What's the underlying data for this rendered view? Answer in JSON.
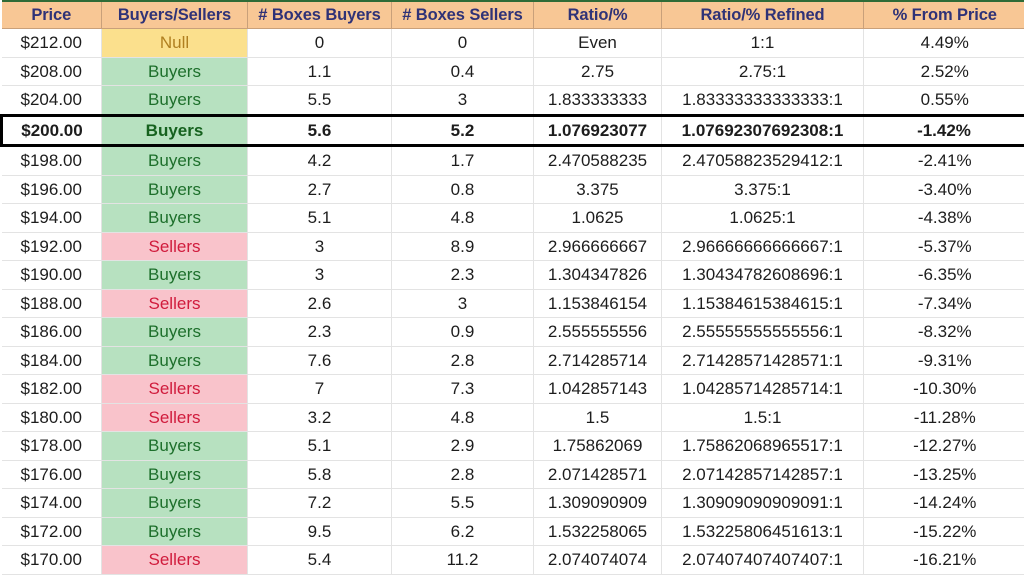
{
  "table": {
    "columns": [
      {
        "key": "price",
        "label": "Price"
      },
      {
        "key": "signal",
        "label": "Buyers/Sellers"
      },
      {
        "key": "boxes_buyers",
        "label": "# Boxes Buyers"
      },
      {
        "key": "boxes_sellers",
        "label": "# Boxes Sellers"
      },
      {
        "key": "ratio",
        "label": "Ratio/%"
      },
      {
        "key": "refined",
        "label": "Ratio/% Refined"
      },
      {
        "key": "pct",
        "label": "% From Price"
      }
    ],
    "colors": {
      "header_bg": "#f8c795",
      "header_text": "#2f3277",
      "header_top_rule": "#2f6b37",
      "buyers_bg": "#b7e1c0",
      "buyers_text": "#1d6f2b",
      "sellers_bg": "#f9c3cb",
      "sellers_text": "#d01b3c",
      "null_bg": "#fbe08d",
      "null_text": "#b07f20",
      "focus_border": "#000000",
      "gridline": "#e3e3e3"
    },
    "focus_row_index": 3,
    "rows": [
      {
        "price": "$212.00",
        "signal": "Null",
        "signal_kind": "null",
        "boxes_buyers": "0",
        "boxes_sellers": "0",
        "ratio": "Even",
        "refined": "1:1",
        "pct": "4.49%"
      },
      {
        "price": "$208.00",
        "signal": "Buyers",
        "signal_kind": "buyers",
        "boxes_buyers": "1.1",
        "boxes_sellers": "0.4",
        "ratio": "2.75",
        "refined": "2.75:1",
        "pct": "2.52%"
      },
      {
        "price": "$204.00",
        "signal": "Buyers",
        "signal_kind": "buyers",
        "boxes_buyers": "5.5",
        "boxes_sellers": "3",
        "ratio": "1.833333333",
        "refined": "1.83333333333333:1",
        "pct": "0.55%"
      },
      {
        "price": "$200.00",
        "signal": "Buyers",
        "signal_kind": "buyers",
        "boxes_buyers": "5.6",
        "boxes_sellers": "5.2",
        "ratio": "1.076923077",
        "refined": "1.07692307692308:1",
        "pct": "-1.42%"
      },
      {
        "price": "$198.00",
        "signal": "Buyers",
        "signal_kind": "buyers",
        "boxes_buyers": "4.2",
        "boxes_sellers": "1.7",
        "ratio": "2.470588235",
        "refined": "2.47058823529412:1",
        "pct": "-2.41%"
      },
      {
        "price": "$196.00",
        "signal": "Buyers",
        "signal_kind": "buyers",
        "boxes_buyers": "2.7",
        "boxes_sellers": "0.8",
        "ratio": "3.375",
        "refined": "3.375:1",
        "pct": "-3.40%"
      },
      {
        "price": "$194.00",
        "signal": "Buyers",
        "signal_kind": "buyers",
        "boxes_buyers": "5.1",
        "boxes_sellers": "4.8",
        "ratio": "1.0625",
        "refined": "1.0625:1",
        "pct": "-4.38%"
      },
      {
        "price": "$192.00",
        "signal": "Sellers",
        "signal_kind": "sellers",
        "boxes_buyers": "3",
        "boxes_sellers": "8.9",
        "ratio": "2.966666667",
        "refined": "2.96666666666667:1",
        "pct": "-5.37%"
      },
      {
        "price": "$190.00",
        "signal": "Buyers",
        "signal_kind": "buyers",
        "boxes_buyers": "3",
        "boxes_sellers": "2.3",
        "ratio": "1.304347826",
        "refined": "1.30434782608696:1",
        "pct": "-6.35%"
      },
      {
        "price": "$188.00",
        "signal": "Sellers",
        "signal_kind": "sellers",
        "boxes_buyers": "2.6",
        "boxes_sellers": "3",
        "ratio": "1.153846154",
        "refined": "1.15384615384615:1",
        "pct": "-7.34%"
      },
      {
        "price": "$186.00",
        "signal": "Buyers",
        "signal_kind": "buyers",
        "boxes_buyers": "2.3",
        "boxes_sellers": "0.9",
        "ratio": "2.555555556",
        "refined": "2.55555555555556:1",
        "pct": "-8.32%"
      },
      {
        "price": "$184.00",
        "signal": "Buyers",
        "signal_kind": "buyers",
        "boxes_buyers": "7.6",
        "boxes_sellers": "2.8",
        "ratio": "2.714285714",
        "refined": "2.71428571428571:1",
        "pct": "-9.31%"
      },
      {
        "price": "$182.00",
        "signal": "Sellers",
        "signal_kind": "sellers",
        "boxes_buyers": "7",
        "boxes_sellers": "7.3",
        "ratio": "1.042857143",
        "refined": "1.04285714285714:1",
        "pct": "-10.30%"
      },
      {
        "price": "$180.00",
        "signal": "Sellers",
        "signal_kind": "sellers",
        "boxes_buyers": "3.2",
        "boxes_sellers": "4.8",
        "ratio": "1.5",
        "refined": "1.5:1",
        "pct": "-11.28%"
      },
      {
        "price": "$178.00",
        "signal": "Buyers",
        "signal_kind": "buyers",
        "boxes_buyers": "5.1",
        "boxes_sellers": "2.9",
        "ratio": "1.75862069",
        "refined": "1.75862068965517:1",
        "pct": "-12.27%"
      },
      {
        "price": "$176.00",
        "signal": "Buyers",
        "signal_kind": "buyers",
        "boxes_buyers": "5.8",
        "boxes_sellers": "2.8",
        "ratio": "2.071428571",
        "refined": "2.07142857142857:1",
        "pct": "-13.25%"
      },
      {
        "price": "$174.00",
        "signal": "Buyers",
        "signal_kind": "buyers",
        "boxes_buyers": "7.2",
        "boxes_sellers": "5.5",
        "ratio": "1.309090909",
        "refined": "1.30909090909091:1",
        "pct": "-14.24%"
      },
      {
        "price": "$172.00",
        "signal": "Buyers",
        "signal_kind": "buyers",
        "boxes_buyers": "9.5",
        "boxes_sellers": "6.2",
        "ratio": "1.532258065",
        "refined": "1.53225806451613:1",
        "pct": "-15.22%"
      },
      {
        "price": "$170.00",
        "signal": "Sellers",
        "signal_kind": "sellers",
        "boxes_buyers": "5.4",
        "boxes_sellers": "11.2",
        "ratio": "2.074074074",
        "refined": "2.07407407407407:1",
        "pct": "-16.21%"
      }
    ]
  }
}
